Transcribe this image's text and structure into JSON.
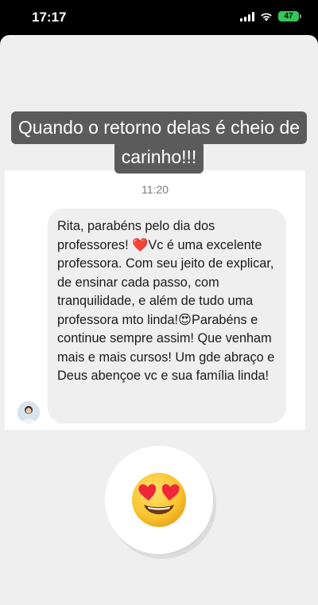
{
  "status_bar": {
    "time": "17:17",
    "battery": "47",
    "icons": [
      "cellular-signal-icon",
      "wifi-icon",
      "battery-icon"
    ]
  },
  "story": {
    "caption_line1": "Quando o retorno delas é cheio de",
    "caption_line2": "carinho!!!",
    "message": {
      "time": "11:20",
      "text": "Rita, parabéns pelo dia dos professores! ❤️Vc é uma excelente professora. Com seu jeito de explicar, de ensinar cada passo, com tranquilidade, e além de tudo uma professora mto linda!😍Parabéns e continue sempre assim! Que venham mais e mais cursos! Um gde abraço e Deus abençoe vc e sua família linda!"
    },
    "sticker": "heart-eyes-emoji"
  },
  "colors": {
    "caption_bg": "#5b5b5b",
    "bubble_bg": "#efefef",
    "story_bg": "#efefef",
    "battery": "#34c759"
  }
}
